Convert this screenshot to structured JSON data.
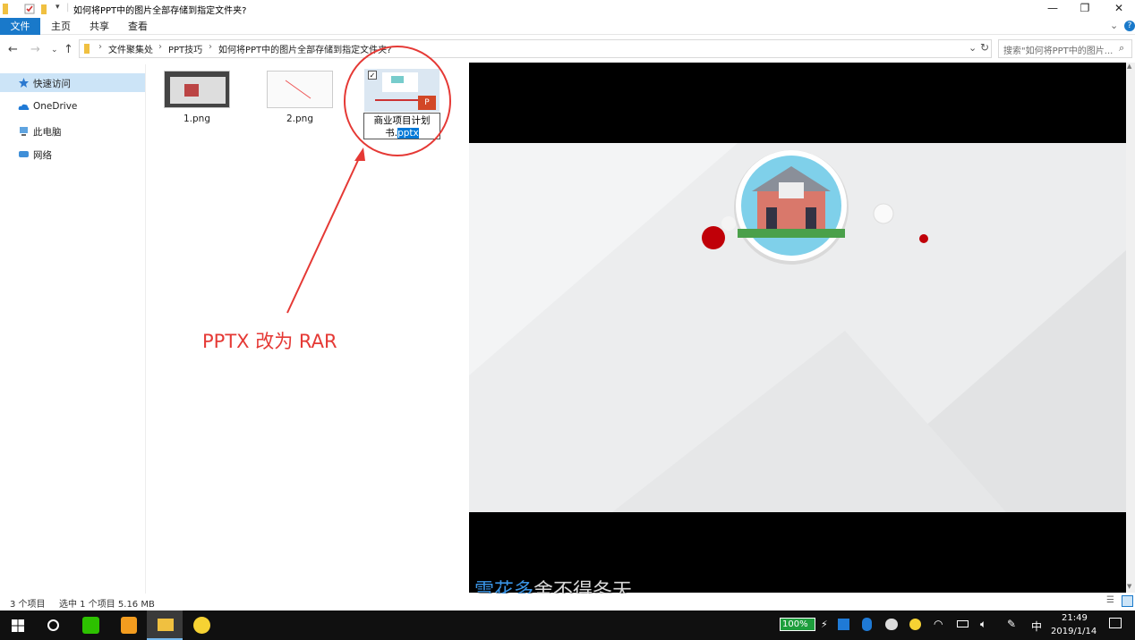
{
  "window": {
    "title": "如何将PPT中的图片全部存储到指定文件夹?",
    "buttons": {
      "minimize": "—",
      "maximize": "❐",
      "close": "✕"
    }
  },
  "ribbon": {
    "tabs": [
      {
        "label": "文件"
      },
      {
        "label": "主页"
      },
      {
        "label": "共享"
      },
      {
        "label": "查看"
      }
    ]
  },
  "address": {
    "crumbs": [
      "文件聚集处",
      "PPT技巧",
      "如何将PPT中的图片全部存储到指定文件夹?"
    ],
    "search_placeholder": "搜索\"如何将PPT中的图片..."
  },
  "sidebar": {
    "items": [
      {
        "label": "快速访问",
        "icon": "star-icon"
      },
      {
        "label": "OneDrive",
        "icon": "cloud-icon"
      },
      {
        "label": "此电脑",
        "icon": "computer-icon"
      },
      {
        "label": "网络",
        "icon": "network-icon"
      }
    ]
  },
  "files": [
    {
      "name": "1.png"
    },
    {
      "name": "2.png"
    },
    {
      "name_prefix": "商业项目计划书.",
      "name_ext": "pptx",
      "selected": true
    }
  ],
  "annotation": {
    "text": "PPTX 改为  RAR"
  },
  "subtitle": {
    "highlight": "雪花多",
    "rest": "舍不得冬天"
  },
  "status": {
    "count": "3 个项目",
    "selection": "选中 1 个项目  5.16 MB"
  },
  "taskbar": {
    "battery": "100%",
    "ime": "中",
    "time": "21:49",
    "date": "2019/1/14"
  },
  "colors": {
    "accent": "#1979ca",
    "annotation": "#e53935",
    "selection": "#cce4f7"
  }
}
